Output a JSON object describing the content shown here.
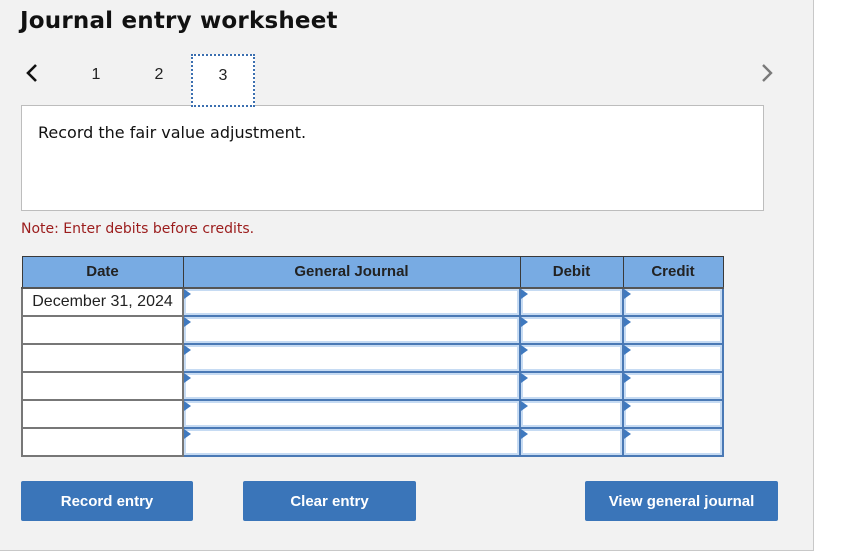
{
  "title": "Journal entry worksheet",
  "navigation": {
    "prev_icon": "chevron-left-icon",
    "next_icon": "chevron-right-icon",
    "tabs": [
      {
        "label": "1",
        "active": false
      },
      {
        "label": "2",
        "active": false
      },
      {
        "label": "3",
        "active": true
      }
    ]
  },
  "instruction": "Record the fair value adjustment.",
  "note": "Note: Enter debits before credits.",
  "journal": {
    "columns": [
      "Date",
      "General Journal",
      "Debit",
      "Credit"
    ],
    "rows": [
      {
        "date": "December 31, 2024",
        "account": "",
        "debit": "",
        "credit": ""
      },
      {
        "date": "",
        "account": "",
        "debit": "",
        "credit": ""
      },
      {
        "date": "",
        "account": "",
        "debit": "",
        "credit": ""
      },
      {
        "date": "",
        "account": "",
        "debit": "",
        "credit": ""
      },
      {
        "date": "",
        "account": "",
        "debit": "",
        "credit": ""
      },
      {
        "date": "",
        "account": "",
        "debit": "",
        "credit": ""
      }
    ]
  },
  "buttons": {
    "record": "Record entry",
    "clear": "Clear entry",
    "view": "View general journal"
  },
  "colors": {
    "header_bg": "#78abe3",
    "button_bg": "#3a75b9",
    "note_text": "#9b1c1c",
    "active_tab_border": "#3b6fb0"
  }
}
